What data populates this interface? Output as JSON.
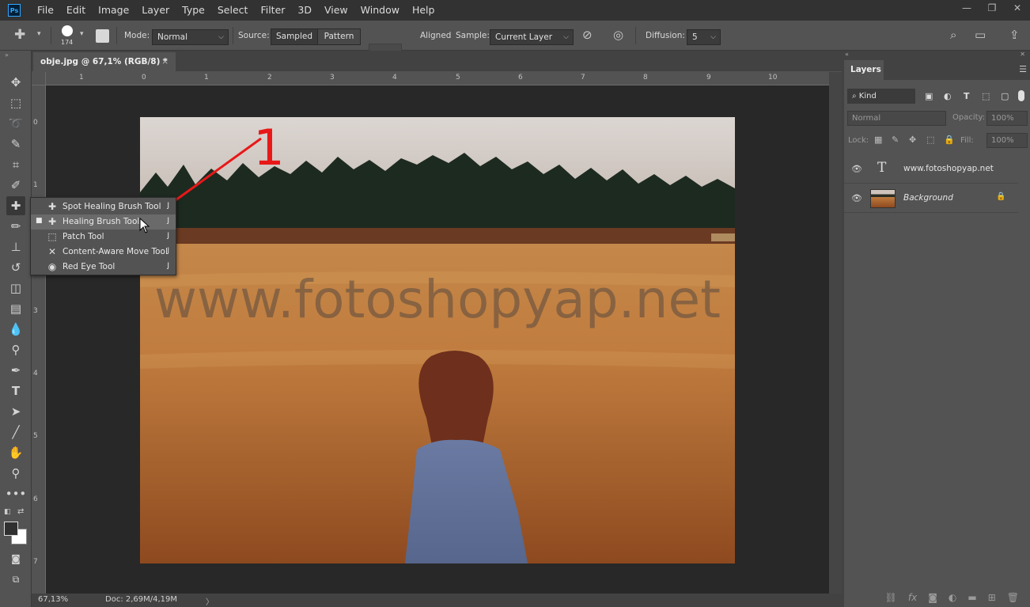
{
  "menu": [
    "File",
    "Edit",
    "Image",
    "Layer",
    "Type",
    "Select",
    "Filter",
    "3D",
    "View",
    "Window",
    "Help"
  ],
  "app_logo": "Ps",
  "window_controls": [
    "—",
    "❐",
    "✕"
  ],
  "options": {
    "brush_size": "174",
    "mode_label": "Mode:",
    "mode_value": "Normal",
    "source_label": "Source:",
    "source_sampled": "Sampled",
    "source_pattern": "Pattern",
    "aligned_label": "Aligned",
    "sample_label": "Sample:",
    "sample_value": "Current Layer",
    "diffusion_label": "Diffusion:",
    "diffusion_value": "5"
  },
  "document": {
    "tab_title": "obje.jpg @ 67,1% (RGB/8) *",
    "close": "×",
    "watermark": "www.fotoshopyap.net",
    "annotation": "1"
  },
  "ruler_top": [
    "1",
    "0",
    "1",
    "2",
    "3",
    "4",
    "5",
    "6",
    "7",
    "8",
    "9",
    "10"
  ],
  "ruler_left": [
    "0",
    "1",
    "2",
    "3",
    "4",
    "5",
    "6",
    "7"
  ],
  "status": {
    "zoom": "67,13%",
    "doc": "Doc: 2,69M/4,19M",
    "arrow": "〉"
  },
  "flyout": {
    "items": [
      {
        "label": "Spot Healing Brush Tool",
        "key": "J",
        "icon": "spot-healing-icon",
        "glyph": "✚"
      },
      {
        "label": "Healing Brush Tool",
        "key": "J",
        "icon": "healing-brush-icon",
        "glyph": "✚"
      },
      {
        "label": "Patch Tool",
        "key": "J",
        "icon": "patch-icon",
        "glyph": "⬚"
      },
      {
        "label": "Content-Aware Move Tool",
        "key": "J",
        "icon": "content-aware-move-icon",
        "glyph": "✕"
      },
      {
        "label": "Red Eye Tool",
        "key": "J",
        "icon": "red-eye-icon",
        "glyph": "◉"
      }
    ],
    "active_marker": "■"
  },
  "layers": {
    "tab": "Layers",
    "kind": "Kind",
    "blend": "Normal",
    "opacity_label": "Opacity:",
    "opacity_value": "100%",
    "lock_label": "Lock:",
    "fill_label": "Fill:",
    "fill_value": "100%",
    "rows": [
      {
        "name": "www.fotoshopyap.net",
        "type": "text"
      },
      {
        "name": "Background",
        "type": "image"
      }
    ]
  },
  "colors": {
    "accent": "#31a8ff",
    "annotation_red": "#e81818"
  }
}
